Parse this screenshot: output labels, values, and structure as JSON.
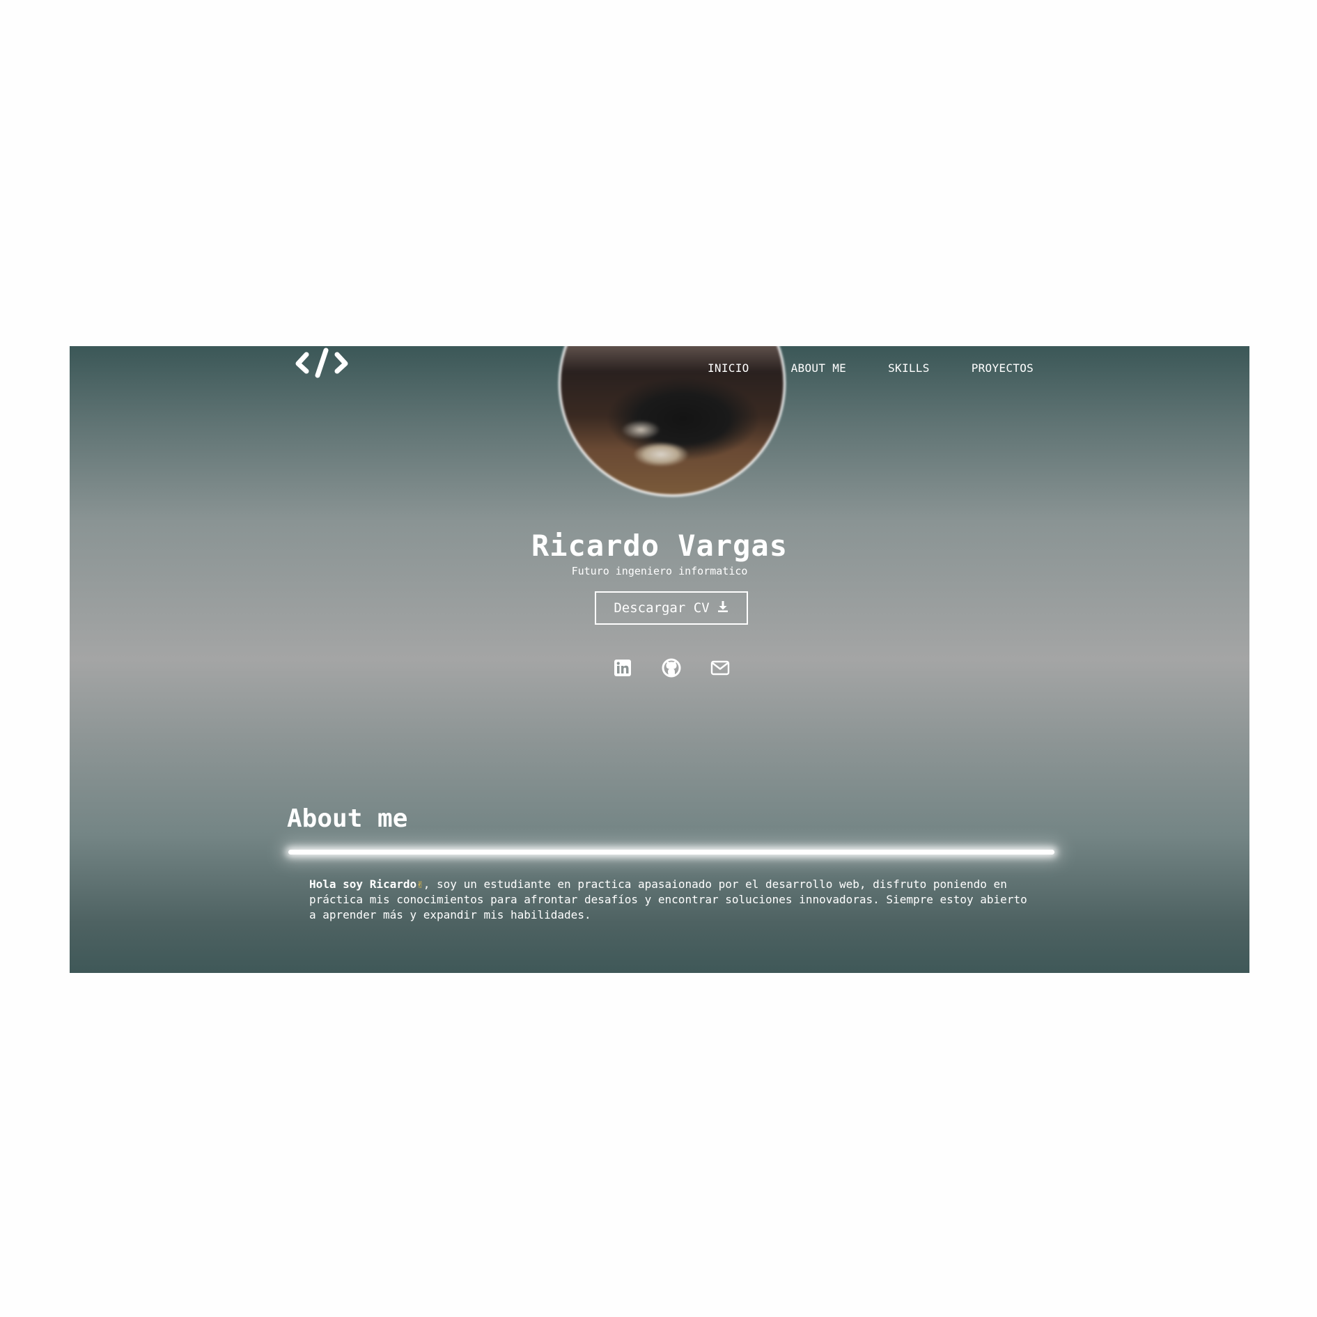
{
  "nav": {
    "items": [
      {
        "label": "INICIO"
      },
      {
        "label": "ABOUT ME"
      },
      {
        "label": "SKILLS"
      },
      {
        "label": "PROYECTOS"
      }
    ]
  },
  "logo": {
    "icon": "code-brackets-icon"
  },
  "hero": {
    "name": "Ricardo Vargas",
    "subtitle": "Futuro ingeniero informatico",
    "cv_button_label": "Descargar CV",
    "cv_icon": "download-icon"
  },
  "socials": [
    {
      "icon": "linkedin-icon"
    },
    {
      "icon": "github-icon"
    },
    {
      "icon": "mail-icon"
    }
  ],
  "about": {
    "title": "About me",
    "greeting": "Hola soy Ricardo",
    "emoji": "✌",
    "body": ", soy un estudiante en practica apasaionado por el desarrollo web, disfruto poniendo en práctica mis conocimientos para afrontar desafíos y encontrar soluciones innovadoras. Siempre estoy abierto a aprender más y expandir mis habilidades."
  },
  "colors": {
    "background_top": "#3b5757",
    "background_mid": "#a4a5a5",
    "text": "#ffffff",
    "emoji": "#f4c542"
  }
}
